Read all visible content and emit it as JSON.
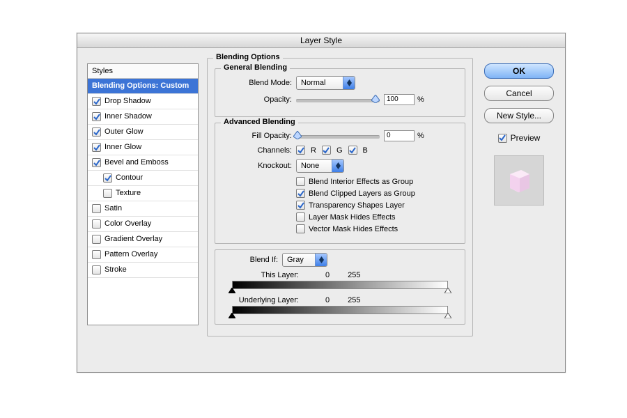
{
  "window": {
    "title": "Layer Style"
  },
  "sidebar": {
    "header": "Styles",
    "items": [
      {
        "label": "Blending Options: Custom",
        "checked": null,
        "selected": true,
        "indent": 0
      },
      {
        "label": "Drop Shadow",
        "checked": true,
        "selected": false,
        "indent": 0
      },
      {
        "label": "Inner Shadow",
        "checked": true,
        "selected": false,
        "indent": 0
      },
      {
        "label": "Outer Glow",
        "checked": true,
        "selected": false,
        "indent": 0
      },
      {
        "label": "Inner Glow",
        "checked": true,
        "selected": false,
        "indent": 0
      },
      {
        "label": "Bevel and Emboss",
        "checked": true,
        "selected": false,
        "indent": 0
      },
      {
        "label": "Contour",
        "checked": true,
        "selected": false,
        "indent": 1
      },
      {
        "label": "Texture",
        "checked": false,
        "selected": false,
        "indent": 1
      },
      {
        "label": "Satin",
        "checked": false,
        "selected": false,
        "indent": 0
      },
      {
        "label": "Color Overlay",
        "checked": false,
        "selected": false,
        "indent": 0
      },
      {
        "label": "Gradient Overlay",
        "checked": false,
        "selected": false,
        "indent": 0
      },
      {
        "label": "Pattern Overlay",
        "checked": false,
        "selected": false,
        "indent": 0
      },
      {
        "label": "Stroke",
        "checked": false,
        "selected": false,
        "indent": 0
      }
    ]
  },
  "blending": {
    "outer_legend": "Blending Options",
    "general_legend": "General Blending",
    "advanced_legend": "Advanced Blending",
    "blend_mode_label": "Blend Mode:",
    "blend_mode_value": "Normal",
    "opacity_label": "Opacity:",
    "opacity_value": "100",
    "percent": "%",
    "fill_opacity_label": "Fill Opacity:",
    "fill_opacity_value": "0",
    "channels_label": "Channels:",
    "channel_r": "R",
    "channel_g": "G",
    "channel_b": "B",
    "channel_r_checked": true,
    "channel_g_checked": true,
    "channel_b_checked": true,
    "knockout_label": "Knockout:",
    "knockout_value": "None",
    "opts": [
      {
        "label": "Blend Interior Effects as Group",
        "checked": false
      },
      {
        "label": "Blend Clipped Layers as Group",
        "checked": true
      },
      {
        "label": "Transparency Shapes Layer",
        "checked": true
      },
      {
        "label": "Layer Mask Hides Effects",
        "checked": false
      },
      {
        "label": "Vector Mask Hides Effects",
        "checked": false
      }
    ]
  },
  "blendif": {
    "label": "Blend If:",
    "channel": "Gray",
    "this_layer_label": "This Layer:",
    "this_low": "0",
    "this_high": "255",
    "under_label": "Underlying Layer:",
    "under_low": "0",
    "under_high": "255"
  },
  "buttons": {
    "ok": "OK",
    "cancel": "Cancel",
    "new_style": "New Style...",
    "preview": "Preview",
    "preview_checked": true
  }
}
